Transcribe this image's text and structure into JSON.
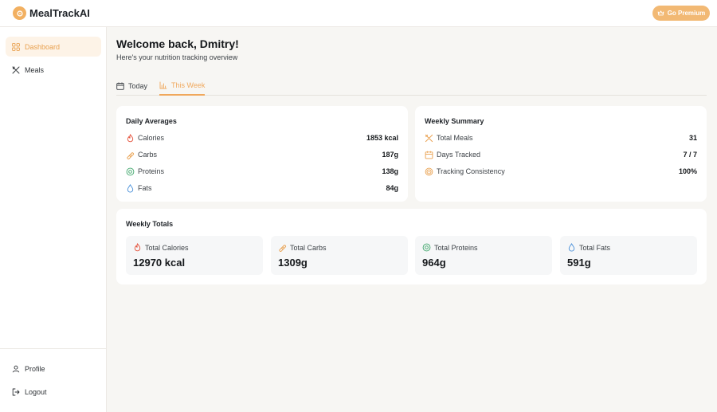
{
  "app": {
    "name": "MealTrackAI",
    "premium_button": "Go Premium"
  },
  "sidebar": {
    "items": [
      {
        "label": "Dashboard",
        "icon": "grid-icon",
        "active": true
      },
      {
        "label": "Meals",
        "icon": "utensils-icon",
        "active": false
      }
    ],
    "bottom_items": [
      {
        "label": "Profile",
        "icon": "user-icon"
      },
      {
        "label": "Logout",
        "icon": "logout-icon"
      }
    ]
  },
  "header": {
    "title": "Welcome back, Dmitry!",
    "subtitle": "Here's your nutrition tracking overview"
  },
  "tabs": [
    {
      "label": "Today",
      "icon": "calendar-icon",
      "active": false
    },
    {
      "label": "This Week",
      "icon": "bar-chart-icon",
      "active": true
    }
  ],
  "daily_averages": {
    "title": "Daily Averages",
    "rows": [
      {
        "label": "Calories",
        "value": "1853 kcal",
        "icon": "flame-icon",
        "color": "#e5533d"
      },
      {
        "label": "Carbs",
        "value": "187g",
        "icon": "bread-icon",
        "color": "#e9a04e"
      },
      {
        "label": "Proteins",
        "value": "138g",
        "icon": "meat-icon",
        "color": "#3fa66b"
      },
      {
        "label": "Fats",
        "value": "84g",
        "icon": "droplet-icon",
        "color": "#4a90d9"
      }
    ]
  },
  "weekly_summary": {
    "title": "Weekly Summary",
    "rows": [
      {
        "label": "Total Meals",
        "value": "31",
        "icon": "utensils-icon"
      },
      {
        "label": "Days Tracked",
        "value": "7 / 7",
        "icon": "calendar-icon"
      },
      {
        "label": "Tracking Consistency",
        "value": "100%",
        "icon": "target-icon"
      }
    ]
  },
  "weekly_totals": {
    "title": "Weekly Totals",
    "items": [
      {
        "label": "Total Calories",
        "value": "12970 kcal",
        "icon": "flame-icon"
      },
      {
        "label": "Total Carbs",
        "value": "1309g",
        "icon": "bread-icon"
      },
      {
        "label": "Total Proteins",
        "value": "964g",
        "icon": "meat-icon"
      },
      {
        "label": "Total Fats",
        "value": "591g",
        "icon": "droplet-icon"
      }
    ]
  },
  "colors": {
    "accent": "#f0a85c",
    "accent_light": "#fdf3e7",
    "calories": "#e5533d",
    "carbs": "#e9a04e",
    "proteins": "#3fa66b",
    "fats": "#4a90d9",
    "background": "#f7f6f3"
  }
}
